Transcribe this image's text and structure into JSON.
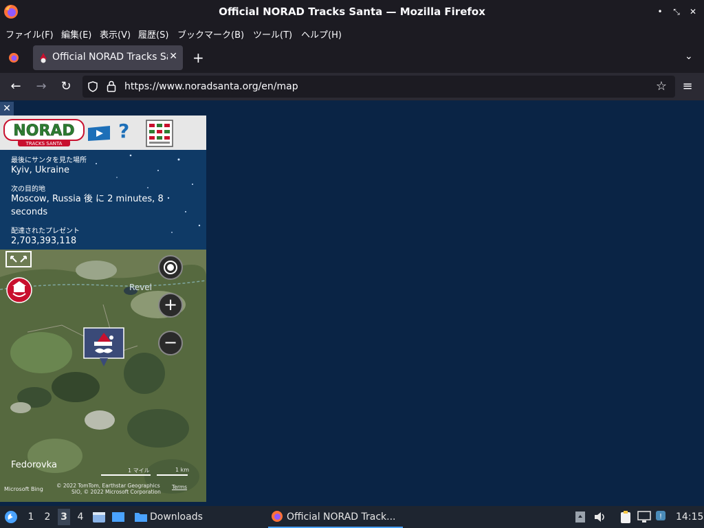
{
  "window": {
    "title": "Official NORAD Tracks Santa — Mozilla Firefox"
  },
  "menu": [
    "ファイル(F)",
    "編集(E)",
    "表示(V)",
    "履歴(S)",
    "ブックマーク(B)",
    "ツール(T)",
    "ヘルプ(H)"
  ],
  "tab": {
    "label": "Official NORAD Tracks Santa"
  },
  "nav": {
    "url": "https://www.noradsanta.org/en/map"
  },
  "panel": {
    "last_seen_label": "最後にサンタを見た場所",
    "last_seen_value": "Kyiv, Ukraine",
    "next_label": "次の目的地",
    "next_value": "Moscow, Russia 後 に 2 minutes, 8 seconds",
    "presents_label": "配達されたプレゼント",
    "presents_value": "2,703,393,118",
    "logo_text": "NORAD",
    "logo_sub": "TRACKS SANTA",
    "help_glyph": "?"
  },
  "map": {
    "place_revel": "Revel",
    "place_fedorovka": "Fedorovka",
    "scale_miles": "1 マイル",
    "scale_km": "1 km",
    "attribution_bing": "Microsoft Bing",
    "attribution_line1": "© 2022 TomTom, Earthstar Geographics",
    "attribution_line2": "SIO, © 2022 Microsoft Corporation",
    "attribution_terms": "Terms"
  },
  "taskbar": {
    "workspaces": [
      "1",
      "2",
      "3",
      "4"
    ],
    "active_workspace": "3",
    "downloads_label": "Downloads",
    "active_task": "Official NORAD Track...",
    "clock": "14:15"
  },
  "colors": {
    "page_bg": "#0a2445",
    "panel_bg": "#0f3a66",
    "chrome_bg": "#1c1b22"
  }
}
